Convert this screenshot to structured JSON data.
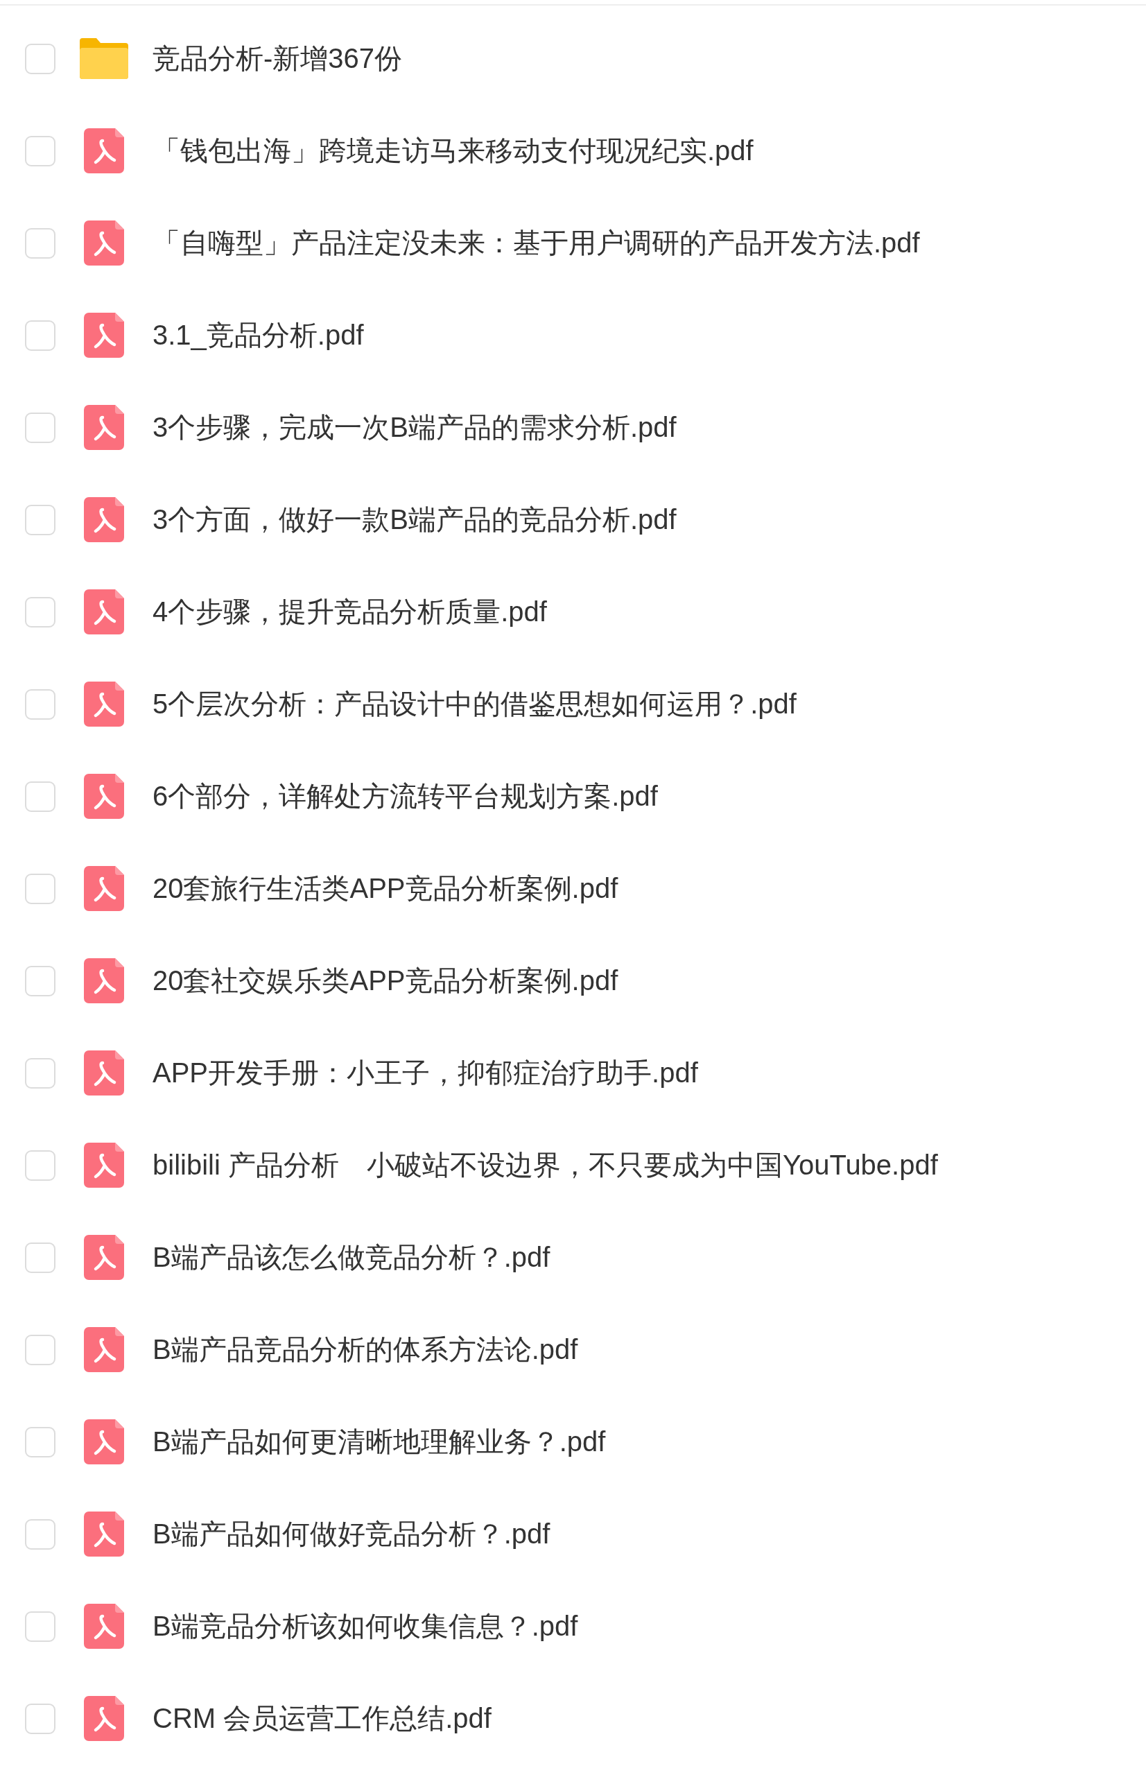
{
  "files": [
    {
      "kind": "folder",
      "name": "竞品分析-新增367份",
      "checked": false
    },
    {
      "kind": "pdf",
      "name": "「钱包出海」跨境走访马来移动支付现况纪实.pdf",
      "checked": false
    },
    {
      "kind": "pdf",
      "name": "「自嗨型」产品注定没未来：基于用户调研的产品开发方法.pdf",
      "checked": false
    },
    {
      "kind": "pdf",
      "name": "3.1_竞品分析.pdf",
      "checked": false
    },
    {
      "kind": "pdf",
      "name": "3个步骤，完成一次B端产品的需求分析.pdf",
      "checked": false
    },
    {
      "kind": "pdf",
      "name": "3个方面，做好一款B端产品的竞品分析.pdf",
      "checked": false
    },
    {
      "kind": "pdf",
      "name": "4个步骤，提升竞品分析质量.pdf",
      "checked": false
    },
    {
      "kind": "pdf",
      "name": "5个层次分析：产品设计中的借鉴思想如何运用？.pdf",
      "checked": false
    },
    {
      "kind": "pdf",
      "name": "6个部分，详解处方流转平台规划方案.pdf",
      "checked": false
    },
    {
      "kind": "pdf",
      "name": "20套旅行生活类APP竞品分析案例.pdf",
      "checked": false
    },
    {
      "kind": "pdf",
      "name": "20套社交娱乐类APP竞品分析案例.pdf",
      "checked": false
    },
    {
      "kind": "pdf",
      "name": "APP开发手册：小王子，抑郁症治疗助手.pdf",
      "checked": false
    },
    {
      "kind": "pdf",
      "name": "bilibili 产品分析　小破站不设边界，不只要成为中国YouTube.pdf",
      "checked": false
    },
    {
      "kind": "pdf",
      "name": "B端产品该怎么做竞品分析？.pdf",
      "checked": false
    },
    {
      "kind": "pdf",
      "name": "B端产品竞品分析的体系方法论.pdf",
      "checked": false
    },
    {
      "kind": "pdf",
      "name": "B端产品如何更清晰地理解业务？.pdf",
      "checked": false
    },
    {
      "kind": "pdf",
      "name": "B端产品如何做好竞品分析？.pdf",
      "checked": false
    },
    {
      "kind": "pdf",
      "name": "B端竞品分析该如何收集信息？.pdf",
      "checked": false
    },
    {
      "kind": "pdf",
      "name": "CRM 会员运营工作总结.pdf",
      "checked": false
    }
  ]
}
